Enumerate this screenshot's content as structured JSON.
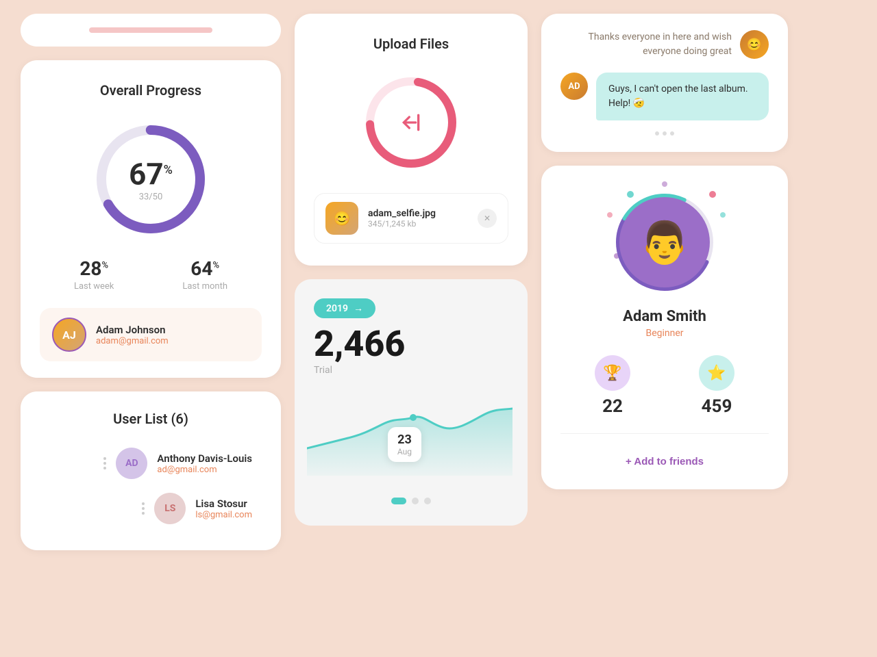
{
  "bg_color": "#f5ddd0",
  "col1": {
    "topbar": {
      "progress_color": "#f5c6c6"
    },
    "progress_card": {
      "title": "Overall Progress",
      "percent": "67",
      "fraction": "33/50",
      "week_val": "28",
      "week_label": "Last week",
      "month_val": "64",
      "month_label": "Last month",
      "user_name": "Adam Johnson",
      "user_email": "adam@gmail.com"
    },
    "user_list": {
      "title": "User List (6)",
      "users": [
        {
          "initials": "AD",
          "name": "Anthony Davis-Louis",
          "email": "ad@gmail.com",
          "bg": "#d4c4e8"
        },
        {
          "initials": "LS",
          "name": "Lisa Stosur",
          "email": "ls@gmail.com",
          "bg": "#e8d4d4"
        }
      ]
    }
  },
  "col2": {
    "upload": {
      "title": "Upload Files",
      "file_name": "adam_selfie.jpg",
      "file_size": "345/1,245 kb"
    },
    "stats": {
      "year": "2019",
      "big_number": "2,466",
      "label": "Trial",
      "tooltip_num": "23",
      "tooltip_label": "Aug"
    }
  },
  "col3": {
    "chat": {
      "message_right": "Thanks everyone in here and wish everyone doing great",
      "message_left": "Guys, I can't open the last album. Help! 🤕",
      "ad_initials": "AD"
    },
    "profile": {
      "name": "Adam Smith",
      "role": "Beginner",
      "stat1_num": "22",
      "stat2_num": "459",
      "add_friend": "+ Add to friends"
    }
  }
}
